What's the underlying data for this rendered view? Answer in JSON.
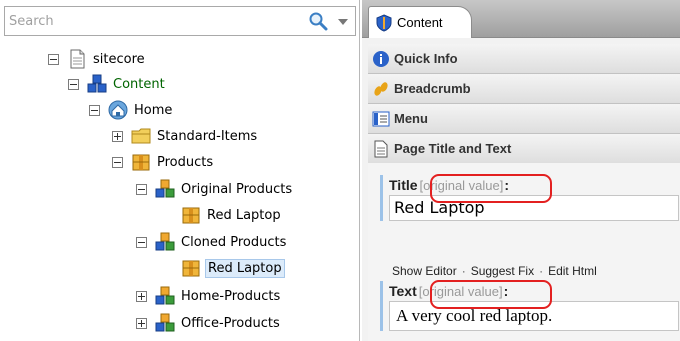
{
  "search": {
    "placeholder": "Search"
  },
  "tree": {
    "nodes": [
      {
        "label": "sitecore",
        "icon": "page-icon"
      },
      {
        "label": "Content",
        "icon": "content-cubes-icon",
        "color": "#006400"
      },
      {
        "label": "Home",
        "icon": "home-icon"
      },
      {
        "label": "Standard-Items",
        "icon": "folder-icon"
      },
      {
        "label": "Products",
        "icon": "package-icon"
      },
      {
        "label": "Original Products",
        "icon": "cubes-icon"
      },
      {
        "label": "Red Laptop",
        "icon": "package-icon"
      },
      {
        "label": "Cloned Products",
        "icon": "cubes-icon"
      },
      {
        "label": "Red Laptop",
        "icon": "package-icon",
        "selected": true
      },
      {
        "label": "Home-Products",
        "icon": "cubes-icon"
      },
      {
        "label": "Office-Products",
        "icon": "cubes-icon"
      }
    ]
  },
  "tabs": [
    {
      "label": "Content",
      "icon": "content-shield-icon"
    }
  ],
  "sections": [
    {
      "label": "Quick Info",
      "icon": "info-icon"
    },
    {
      "label": "Breadcrumb",
      "icon": "breadcrumb-icon"
    },
    {
      "label": "Menu",
      "icon": "menu-icon"
    },
    {
      "label": "Page Title and Text",
      "icon": "document-icon"
    }
  ],
  "fields": {
    "title": {
      "label": "Title",
      "note": "[original value]",
      "colon": ":",
      "value": "Red Laptop"
    },
    "text": {
      "label": "Text",
      "note": "[original value]",
      "colon": ":",
      "value": "A very cool red laptop."
    }
  },
  "rich_text_links": {
    "show_editor": "Show Editor",
    "suggest_fix": "Suggest Fix",
    "edit_html": "Edit Html",
    "separator": "·"
  },
  "colors": {
    "highlight": "#e32020",
    "selection": "#dcebfa",
    "content_label": "#006400"
  }
}
